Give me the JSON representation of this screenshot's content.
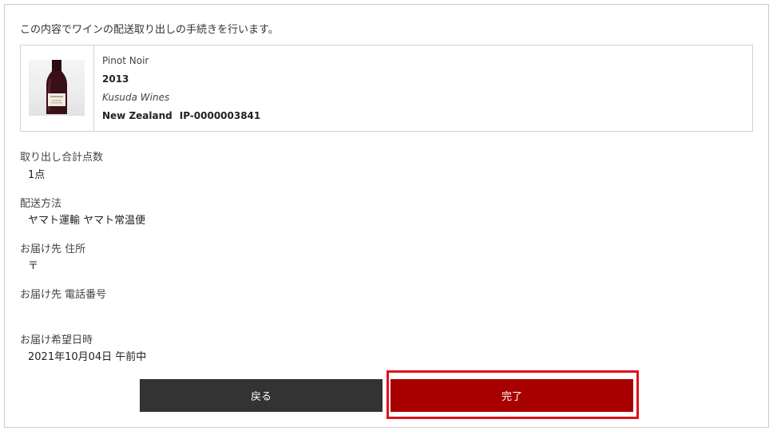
{
  "intro": "この内容でワインの配送取り出しの手続きを行います。",
  "item": {
    "name": "Pinot Noir",
    "vintage": "2013",
    "producer": "Kusuda Wines",
    "country": "New Zealand",
    "code": "IP-0000003841",
    "image_icon": "wine-bottle-icon"
  },
  "fields": {
    "quantity": {
      "label": "取り出し合計点数",
      "value": "1点"
    },
    "shipping": {
      "label": "配送方法",
      "value": "ヤマト運輸 ヤマト常温便"
    },
    "address": {
      "label": "お届け先 住所",
      "value": "〒"
    },
    "phone": {
      "label": "お届け先 電話番号",
      "value": ""
    },
    "datetime": {
      "label": "お届け希望日時",
      "value": "2021年10月04日 午前中"
    }
  },
  "buttons": {
    "back": "戻る",
    "complete": "完了"
  },
  "colors": {
    "back_button": "#333333",
    "complete_button": "#a80000",
    "highlight_border": "#e0121a"
  }
}
